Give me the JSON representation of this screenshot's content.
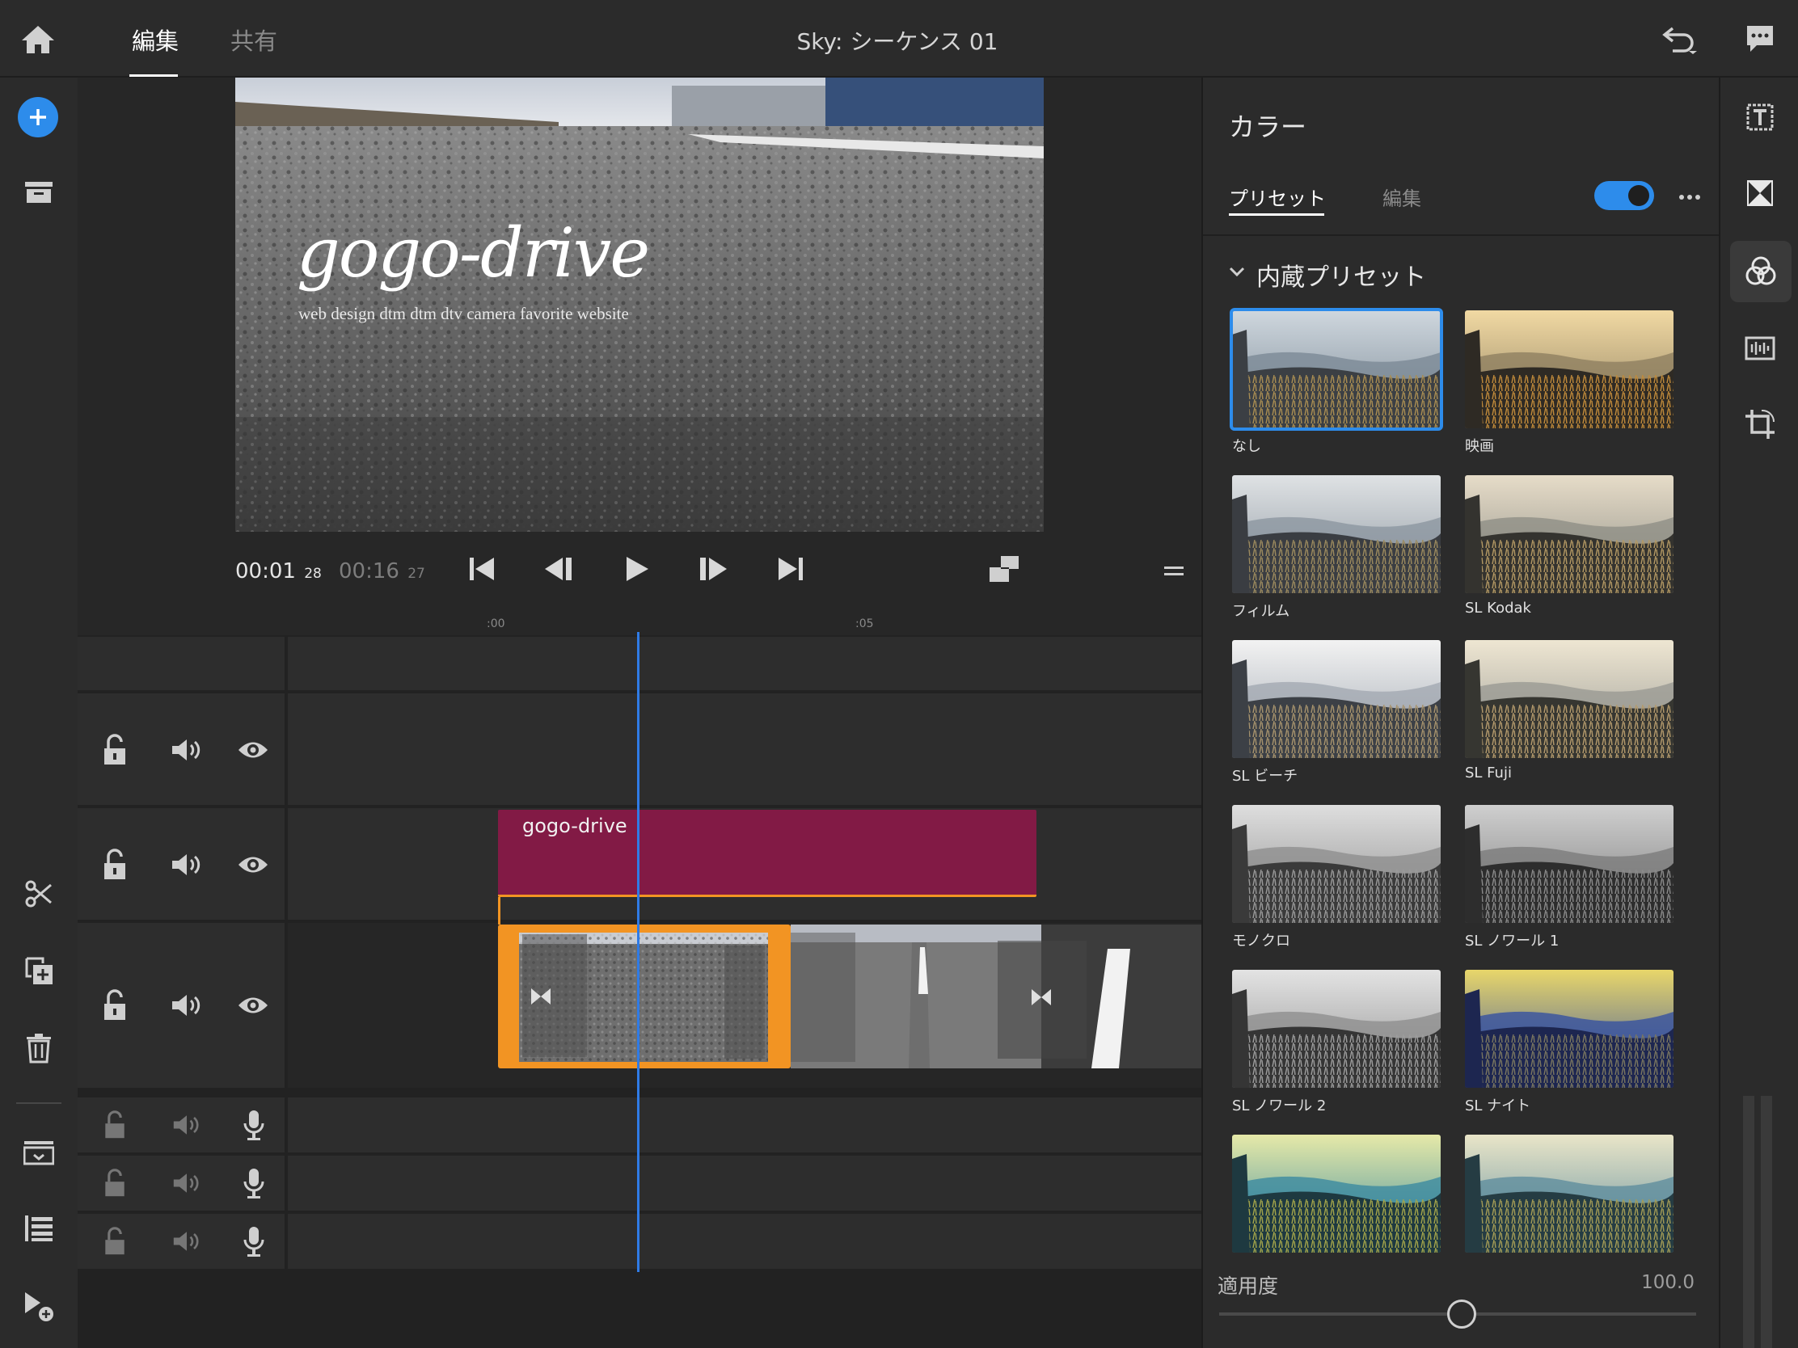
{
  "header": {
    "tabs": [
      {
        "label": "編集"
      },
      {
        "label": "共有"
      }
    ],
    "title": "Sky: シーケンス 01"
  },
  "player": {
    "current_time": "00:01",
    "current_frames": "28",
    "total_time": "00:16",
    "total_frames": "27",
    "overlay_title": "gogo-drive",
    "overlay_subtitle": "web design dtm dtm dtv camera favorite website"
  },
  "timeline": {
    "ruler_marks": [
      ":00",
      ":05"
    ],
    "title_clip_label": "gogo-drive"
  },
  "color_panel": {
    "title": "カラー",
    "tabs": [
      {
        "label": "プリセット"
      },
      {
        "label": "編集"
      }
    ],
    "enabled": true,
    "section_title": "内蔵プリセット",
    "presets": [
      {
        "label": "なし",
        "selected": true
      },
      {
        "label": "映画"
      },
      {
        "label": "フィルム"
      },
      {
        "label": "SL Kodak"
      },
      {
        "label": "SL ビーチ"
      },
      {
        "label": "SL Fuji"
      },
      {
        "label": "モノクロ"
      },
      {
        "label": "SL ノワール 1"
      },
      {
        "label": "SL ノワール 2"
      },
      {
        "label": "SL ナイト"
      },
      {
        "label": ""
      },
      {
        "label": ""
      }
    ],
    "intensity_label": "適用度",
    "intensity_value": "100.0"
  },
  "colors": {
    "accent": "#2d8ceb",
    "title_clip": "#821a45",
    "selected_clip": "#f29423",
    "playhead": "#2f7be6"
  }
}
